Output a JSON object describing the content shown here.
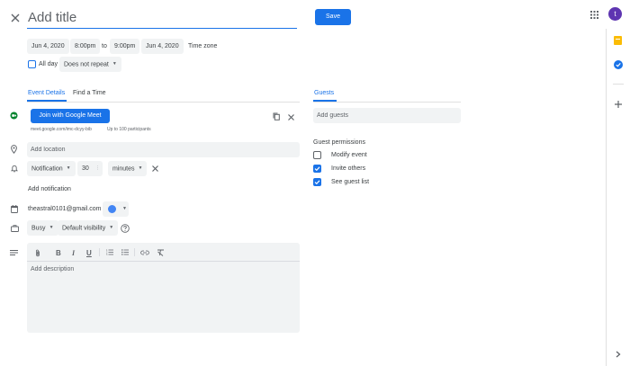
{
  "header": {
    "title_placeholder": "Add title",
    "save_label": "Save",
    "avatar_letter": "t"
  },
  "datetime": {
    "start_date": "Jun 4, 2020",
    "start_time": "8:00pm",
    "separator": "to",
    "end_time": "9:00pm",
    "end_date": "Jun 4, 2020",
    "timezone_label": "Time zone",
    "all_day_label": "All day",
    "all_day_checked": false,
    "repeat_value": "Does not repeat"
  },
  "tabs": [
    {
      "label": "Event Details",
      "active": true
    },
    {
      "label": "Find a Time",
      "active": false
    }
  ],
  "meet": {
    "button_label": "Join with Google Meet",
    "link_text": "meet.google.com/imc-dcyy-bib",
    "participants_text": "Up to 100 participants"
  },
  "location": {
    "placeholder": "Add location"
  },
  "notification": {
    "type": "Notification",
    "amount": "30",
    "unit": "minutes",
    "add_label": "Add notification"
  },
  "calendar": {
    "owner": "theastral0101@gmail.com",
    "color": "#4285f4"
  },
  "availability": {
    "status": "Busy",
    "visibility": "Default visibility"
  },
  "description": {
    "placeholder": "Add description"
  },
  "guests": {
    "tab_label": "Guests",
    "input_placeholder": "Add guests",
    "permissions_title": "Guest permissions",
    "permissions": [
      {
        "label": "Modify event",
        "checked": false
      },
      {
        "label": "Invite others",
        "checked": true
      },
      {
        "label": "See guest list",
        "checked": true
      }
    ]
  },
  "colors": {
    "accent": "#1a73e8",
    "input_bg": "#f1f3f4",
    "avatar_bg": "#5e35b1",
    "keep_yellow": "#fbbc04",
    "tasks_blue": "#1a73e8"
  }
}
